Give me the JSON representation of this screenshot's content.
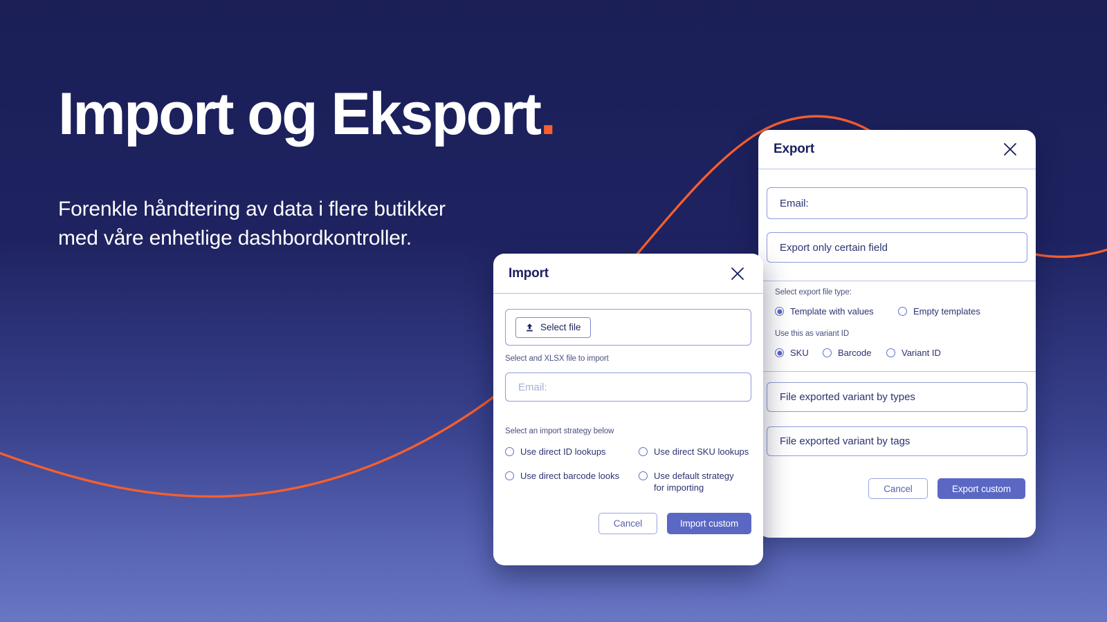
{
  "hero": {
    "title_main": "Import og Eksport",
    "title_dot": ".",
    "subtitle": "Forenkle håndtering av data i flere butikker med våre enhetlige dashbordkontroller."
  },
  "theme": {
    "bg_top": "#1b1f56",
    "bg_bottom": "#6876c4",
    "accent_orange": "#f9602f",
    "accent_indigo": "#5a68c4",
    "dialog_bg": "#ffffff",
    "border_blue": "#8f9ad8"
  },
  "import_dialog": {
    "title": "Import",
    "close_icon": "close-icon",
    "upload_icon": "upload-icon",
    "select_file_label": "Select file",
    "file_helper": "Select and XLSX file to import",
    "email_placeholder": "Email:",
    "email_value": "",
    "strategy_legend": "Select an import strategy below",
    "strategies": [
      {
        "label": "Use direct ID lookups",
        "selected": false
      },
      {
        "label": "Use direct SKU lookups",
        "selected": false
      },
      {
        "label": "Use direct barcode looks",
        "selected": false
      },
      {
        "label": "Use default strategy for importing",
        "selected": false
      }
    ],
    "cancel_label": "Cancel",
    "submit_label": "Import custom"
  },
  "export_dialog": {
    "title": "Export",
    "close_icon": "close-icon",
    "email_placeholder": "Email:",
    "email_value": "Email:",
    "certain_field_value": "Export only certain field",
    "file_type_legend": "Select export file type:",
    "file_types": [
      {
        "label": "Template with values",
        "selected": true
      },
      {
        "label": "Empty templates",
        "selected": false
      }
    ],
    "variant_id_legend": "Use this as variant ID",
    "variant_ids": [
      {
        "label": "SKU",
        "selected": true
      },
      {
        "label": "Barcode",
        "selected": false
      },
      {
        "label": "Variant ID",
        "selected": false
      }
    ],
    "variant_by_types_value": "File exported variant by types",
    "variant_by_tags_value": "File exported variant by tags",
    "cancel_label": "Cancel",
    "submit_label": "Export custom"
  }
}
